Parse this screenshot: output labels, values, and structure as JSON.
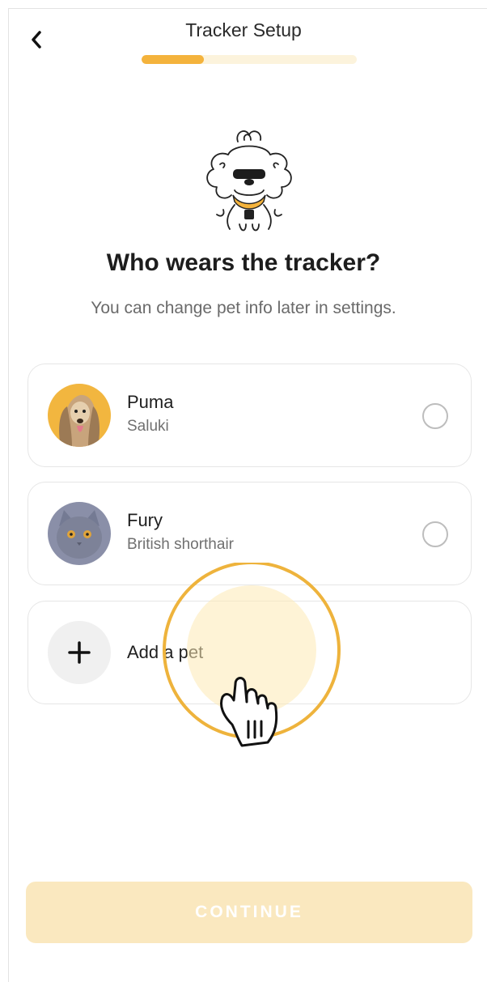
{
  "header": {
    "title": "Tracker Setup",
    "progress_percent": 29
  },
  "main": {
    "title": "Who wears the tracker?",
    "subtitle": "You can change pet info later in settings."
  },
  "pets": [
    {
      "name": "Puma",
      "breed": "Saluki",
      "selected": false,
      "avatar": "dog-photo"
    },
    {
      "name": "Fury",
      "breed": "British shorthair",
      "selected": false,
      "avatar": "cat-photo"
    }
  ],
  "add_pet": {
    "label": "Add a pet",
    "icon": "plus-icon"
  },
  "footer": {
    "continue_label": "CONTINUE"
  },
  "colors": {
    "accent": "#f4b33c",
    "progress_track": "#fcf3dc",
    "continue_disabled": "#fae8bf"
  }
}
